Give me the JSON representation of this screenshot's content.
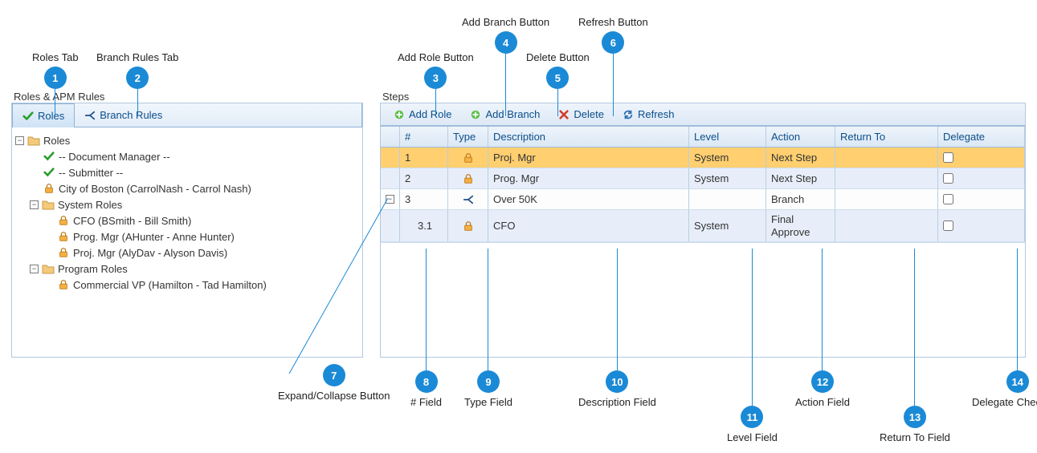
{
  "left_panel": {
    "group_title": "Roles & APM Rules",
    "tabs": {
      "roles": "Roles",
      "branch_rules": "Branch Rules"
    },
    "tree": {
      "root_label": "Roles",
      "doc_manager": "-- Document Manager --",
      "submitter": "-- Submitter --",
      "city_boston": "City of Boston (CarrolNash - Carrol Nash)",
      "system_roles": "System Roles",
      "cfo": "CFO (BSmith - Bill Smith)",
      "prog_mgr": "Prog. Mgr (AHunter - Anne Hunter)",
      "proj_mgr": "Proj. Mgr (AlyDav - Alyson Davis)",
      "program_roles": "Program Roles",
      "commercial_vp": "Commercial VP (Hamilton - Tad Hamilton)"
    }
  },
  "right_panel": {
    "group_title": "Steps",
    "toolbar": {
      "add_role": "Add Role",
      "add_branch": "Add Branch",
      "delete": "Delete",
      "refresh": "Refresh"
    },
    "columns": {
      "num": "#",
      "type": "Type",
      "desc": "Description",
      "level": "Level",
      "action": "Action",
      "return": "Return To",
      "delegate": "Delegate"
    },
    "rows": [
      {
        "num": "1",
        "type": "lock",
        "desc": "Proj. Mgr",
        "level": "System",
        "action": "Next Step",
        "return": "",
        "delegate": false,
        "class": "selected"
      },
      {
        "num": "2",
        "type": "lock",
        "desc": "Prog. Mgr",
        "level": "System",
        "action": "Next Step",
        "return": "",
        "delegate": false,
        "class": "alt"
      },
      {
        "num": "3",
        "type": "branch",
        "desc": "Over 50K",
        "level": "",
        "action": "Branch",
        "return": "",
        "delegate": false,
        "class": "normal",
        "expandable": true
      },
      {
        "num": "3.1",
        "type": "lock",
        "desc": "CFO",
        "level": "System",
        "action": "Final Approve",
        "return": "",
        "delegate": false,
        "class": "alt",
        "indent": true
      }
    ]
  },
  "callouts": {
    "1": "Roles Tab",
    "2": "Branch Rules Tab",
    "3": "Add Role Button",
    "4": "Add Branch Button",
    "5": "Delete Button",
    "6": "Refresh Button",
    "7": "Expand/Collapse Button",
    "8": "# Field",
    "9": "Type Field",
    "10": "Description Field",
    "11": "Level Field",
    "12": "Action Field",
    "13": "Return To Field",
    "14": "Delegate Checkbox"
  }
}
